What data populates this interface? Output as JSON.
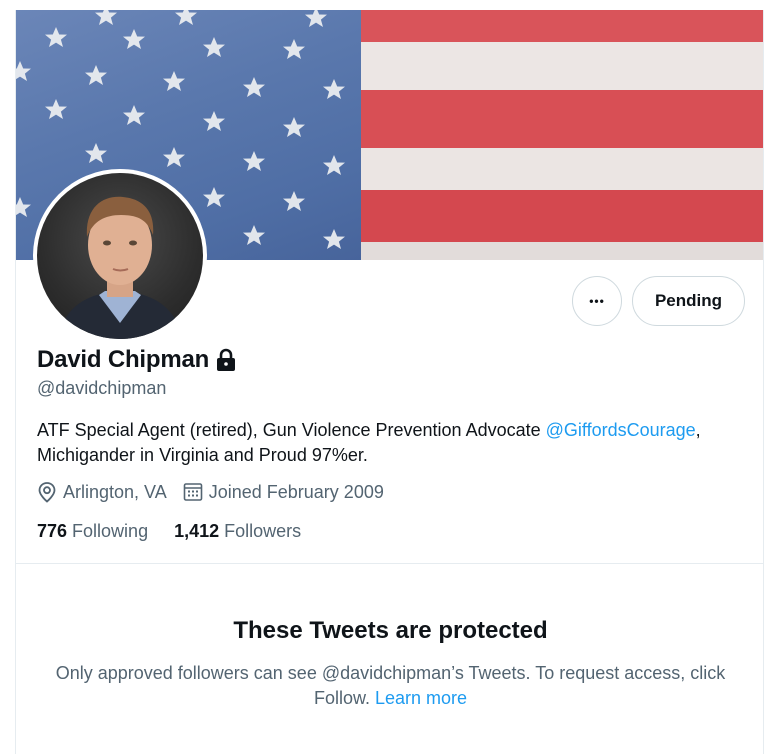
{
  "profile": {
    "name": "David Chipman",
    "handle": "@davidchipman",
    "bio_text": "ATF Special Agent (retired), Gun Violence Prevention Advocate ",
    "bio_mention": "@GiffordsCourage",
    "bio_text_2": ",\nMichigander in Virginia and Proud 97%er.",
    "location": "Arlington, VA",
    "joined": "Joined February 2009",
    "following_count": "776",
    "following_label": "Following",
    "followers_count": "1,412",
    "followers_label": "Followers"
  },
  "actions": {
    "more_label": "•••",
    "pending_label": "Pending"
  },
  "protected": {
    "title": "These Tweets are protected",
    "body": "Only approved followers can see @davidchipman’s Tweets. To request access, click Follow. ",
    "learn_more": "Learn more"
  },
  "icons": {
    "lock": "lock-icon",
    "location": "location-pin-icon",
    "calendar": "calendar-icon"
  },
  "colors": {
    "link": "#1d9bf0",
    "text_primary": "#0f1419",
    "text_secondary": "#536471",
    "border": "#cfd9de"
  }
}
